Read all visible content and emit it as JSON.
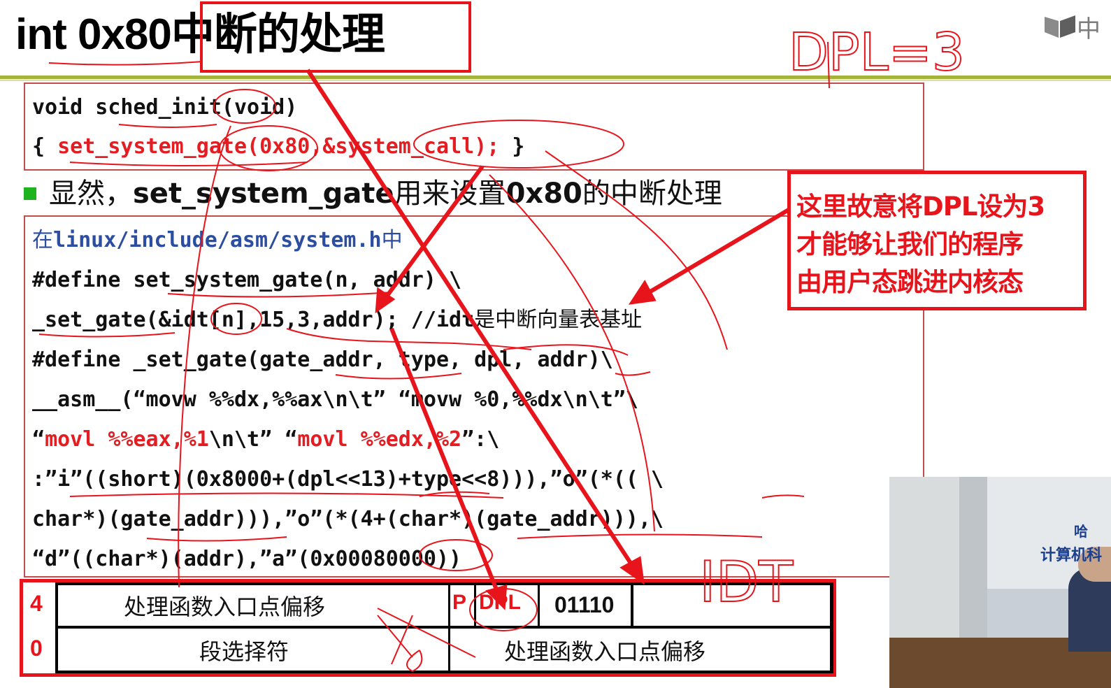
{
  "title": {
    "prefix": "int 0x80",
    "highlight": "中断的处理"
  },
  "handwriting": {
    "dpl_note": "DPL=3",
    "idt_note": "IDT"
  },
  "corner": {
    "char": "中"
  },
  "code_block_1": {
    "line1": "void sched_init(void)",
    "line2_open": "{ ",
    "line2_call": "set_system_gate(0x80,&system_call);",
    "line2_close": " }"
  },
  "bullet": {
    "text_prefix": "显然，",
    "text_bold": "set_system_gate",
    "text_suffix": "用来设置",
    "text_bold2": "0x80",
    "text_end": "的中断处理"
  },
  "code_block_2": {
    "line1_prefix": "在",
    "line1_path": "linux/include/asm/system.h",
    "line1_suffix": "中",
    "line2": "#define set_system_gate(n, addr) \\",
    "line3_code": "_set_gate(&idt[n],15,3,addr); //idt",
    "line3_comment": "是中断向量表基址",
    "line4": "#define _set_gate(gate_addr, type, dpl, addr)\\",
    "line5": "__asm__(“movw %%dx,%%ax\\n\\t” “movw %0,%%dx\\n\\t”\\",
    "line6_q1": "“",
    "line6_red1": "movl %%eax,%1",
    "line6_mid": "\\n\\t” “",
    "line6_red2": "movl %%edx,%2",
    "line6_end": "”:\\",
    "line7": ":”i”((short)(0x8000+(dpl<<13)+type<<8))),”o”(*(( \\",
    "line8": "char*)(gate_addr))),”o”(*(4+(char*)(gate_addr))),\\",
    "line9": "“d”((char*)(addr),”a”(0x00080000))"
  },
  "callout": {
    "line1": "这里故意将DPL设为3",
    "line2": "才能够让我们的程序",
    "line3": "由用户态跳进内核态"
  },
  "idt_table": {
    "row_top_index": "4",
    "row_bottom_index": "0",
    "top_left": "处理函数入口点偏移",
    "p_label": "P",
    "dpl_label": "DPL",
    "type_bits": "01110",
    "bottom_left": "段选择符",
    "bottom_right": "处理函数入口点偏移"
  },
  "video": {
    "text1": "哈",
    "text2": "计算机科"
  },
  "colors": {
    "accent_red": "#e8141b",
    "olive_rule": "#a4b339",
    "bullet_green": "#1fb31f",
    "path_blue": "#2b4ea0"
  }
}
